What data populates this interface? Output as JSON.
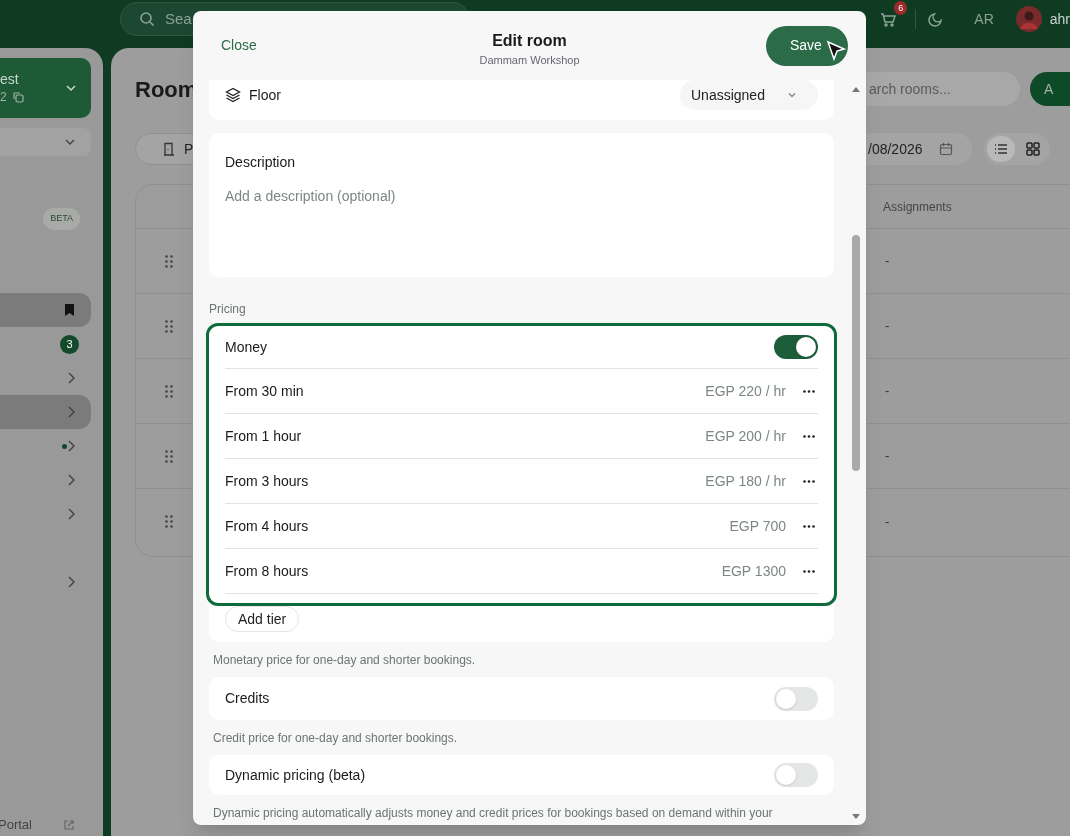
{
  "topbar": {
    "search_placeholder": "Sea",
    "notification_count": "6",
    "language": "AR",
    "user_name": "ahr"
  },
  "sidebar": {
    "workspace_name": "est",
    "workspace_code": "2",
    "items": [
      {
        "kind": "badge",
        "badge": "BETA",
        "selected": false
      },
      {
        "kind": "bookmark",
        "selected": true
      },
      {
        "kind": "count",
        "badge": "3",
        "selected": false
      },
      {
        "kind": "chevron",
        "selected": false
      },
      {
        "kind": "chevron",
        "selected": true
      },
      {
        "kind": "dot",
        "selected": false
      },
      {
        "kind": "chevron",
        "selected": false
      },
      {
        "kind": "chevron",
        "selected": false
      },
      {
        "kind": "chevron",
        "selected": false
      }
    ],
    "portal_link": "Portal"
  },
  "main": {
    "title": "Room",
    "tab_label": "P",
    "search_placeholder": "arch rooms...",
    "add_button": "A",
    "date": "/08/2026",
    "view_buttons": [
      {
        "kind": "list",
        "selected": true
      },
      {
        "kind": "grid",
        "selected": false
      }
    ],
    "table": {
      "columns": [
        "Assignments"
      ],
      "rows": [
        {
          "assignments": "-"
        },
        {
          "assignments": "-"
        },
        {
          "assignments": "-"
        },
        {
          "assignments": "-"
        },
        {
          "assignments": "-"
        }
      ]
    }
  },
  "modal": {
    "close": "Close",
    "title": "Edit room",
    "subtitle": "Dammam Workshop",
    "save": "Save",
    "floor": {
      "label": "Floor",
      "value": "Unassigned"
    },
    "description": {
      "label": "Description",
      "placeholder": "Add a description (optional)"
    },
    "pricing_label": "Pricing",
    "money": {
      "label": "Money",
      "on": true,
      "tiers": [
        {
          "label": "From 30 min",
          "price": "EGP 220 / hr"
        },
        {
          "label": "From 1 hour",
          "price": "EGP 200 / hr"
        },
        {
          "label": "From 3 hours",
          "price": "EGP 180 / hr"
        },
        {
          "label": "From 4 hours",
          "price": "EGP 700"
        },
        {
          "label": "From 8 hours",
          "price": "EGP 1300"
        }
      ],
      "add_button": "Add tier",
      "help": "Monetary price for one-day and shorter bookings."
    },
    "options": [
      {
        "label": "Credits",
        "on": false,
        "help": "Credit price for one-day and shorter bookings."
      },
      {
        "label": "Dynamic pricing (beta)",
        "on": false,
        "help": "Dynamic pricing automatically adjusts money and credit prices for bookings based on demand within your"
      }
    ]
  }
}
